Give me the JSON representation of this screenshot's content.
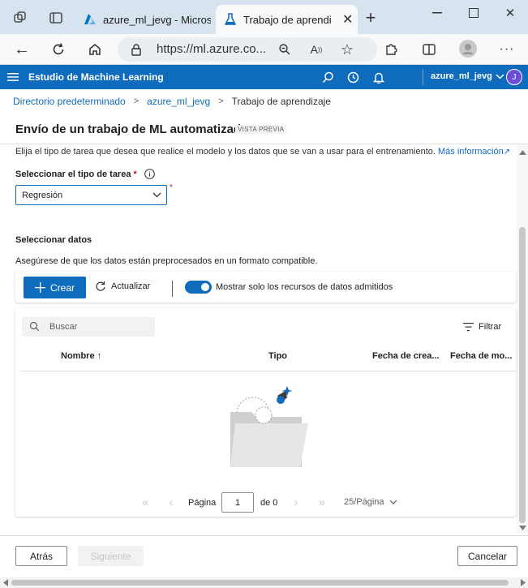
{
  "browser": {
    "tabs": [
      {
        "title": "azure_ml_jevg - Microsoft Azure"
      },
      {
        "title": "Trabajo de aprendizaje"
      }
    ],
    "url": "https://ml.azure.co...",
    "icons": [
      "workspaces-icon",
      "tab-actions-icon",
      "back-icon",
      "refresh-icon",
      "home-icon",
      "lock-icon",
      "zoom-icon",
      "read-aloud-icon",
      "favorite-icon",
      "extensions-icon",
      "split-screen-icon",
      "profile-icon",
      "minimize-icon",
      "maximize-icon",
      "close-icon"
    ]
  },
  "app": {
    "title": "Estudio de Machine Learning",
    "workspace": "azure_ml_jevg",
    "avatar": "J"
  },
  "breadcrumb": [
    "Directorio predeterminado",
    "azure_ml_jevg",
    "Trabajo de aprendizaje"
  ],
  "page": {
    "title": "Envío de un trabajo de ML automatizado",
    "badge": "VISTA PREVIA",
    "intro": "Elija el tipo de tarea que desea que realice el modelo y los datos que se van a usar para el entrenamiento.",
    "more_link": "Más información",
    "task_label": "Seleccionar el tipo de tarea",
    "required_mark": "*",
    "task_value": "Regresión"
  },
  "data_section": {
    "title": "Seleccionar datos",
    "description": "Asegúrese de que los datos están preprocesados en un formato compatible.",
    "create_label": "Crear",
    "refresh_label": "Actualizar",
    "toggle_label": "Mostrar solo los recursos de datos admitidos",
    "toggle_on": true,
    "search_placeholder": "Buscar",
    "filter_label": "Filtrar",
    "columns": [
      "Nombre ↑",
      "Tipo",
      "Fecha de crea...",
      "Fecha de mo..."
    ],
    "pagination": {
      "page_label": "Página",
      "page_value": "1",
      "of_label": "de 0",
      "page_size": "25/Página"
    }
  },
  "footer": {
    "back": "Atrás",
    "next": "Siguiente",
    "cancel": "Cancelar"
  }
}
